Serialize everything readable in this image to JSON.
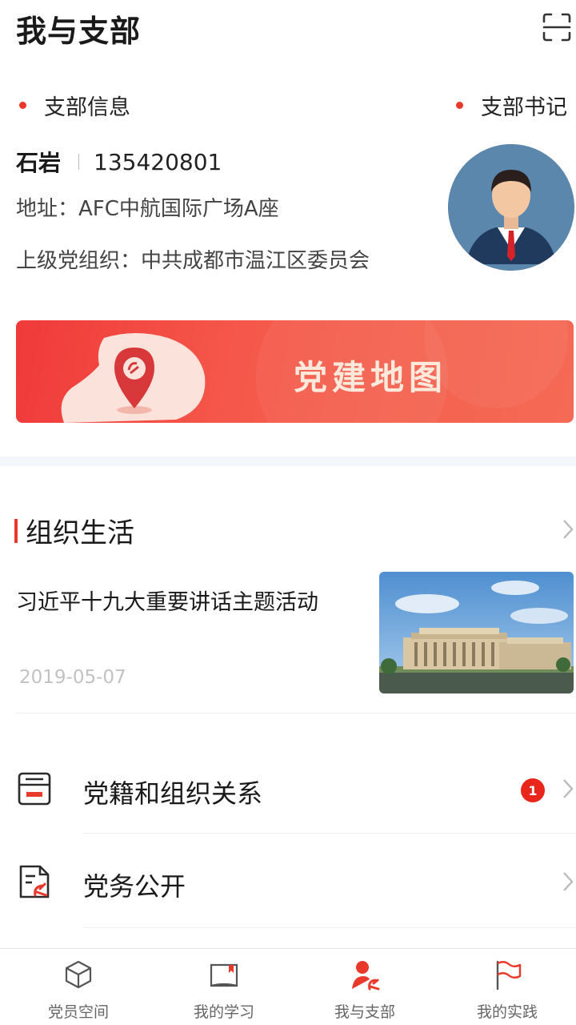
{
  "header": {
    "title": "我与支部",
    "scan_icon": "scan-icon"
  },
  "branch": {
    "info_label": "支部信息",
    "secretary_label": "支部书记",
    "secretary_name": "石岩",
    "phone": "135420801",
    "address": "地址：AFC中航国际广场A座",
    "parent_org": "上级党组织：中共成都市温江区委员会"
  },
  "map_banner": {
    "title": "党建地图",
    "icon": "map-pin-icon"
  },
  "org_life": {
    "title": "组织生活",
    "news": [
      {
        "title": "习近平十九大重要讲话主题活动",
        "date": "2019-05-07"
      }
    ]
  },
  "menu": [
    {
      "label": "党籍和组织关系",
      "icon": "archive-icon",
      "badge": "1"
    },
    {
      "label": "党务公开",
      "icon": "document-party-icon"
    }
  ],
  "tabbar": [
    {
      "label": "党员空间",
      "icon": "cube-icon"
    },
    {
      "label": "我的学习",
      "icon": "book-icon"
    },
    {
      "label": "我与支部",
      "icon": "party-person-icon",
      "active": true
    },
    {
      "label": "我的实践",
      "icon": "flag-icon"
    }
  ],
  "colors": {
    "accent": "#e8392a",
    "badge": "#e8261c",
    "banner_start": "#f03a3a",
    "banner_end": "#f56a55"
  }
}
